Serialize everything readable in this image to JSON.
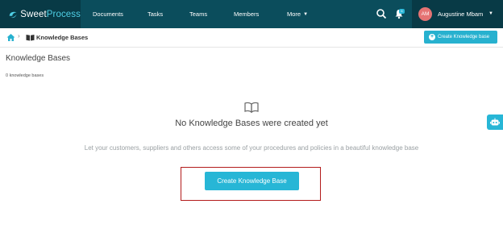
{
  "brand": {
    "name_part1": "Sweet",
    "name_part2": "Process"
  },
  "nav": {
    "items": [
      {
        "label": "Documents"
      },
      {
        "label": "Tasks"
      },
      {
        "label": "Teams"
      },
      {
        "label": "Members"
      },
      {
        "label": "More"
      }
    ],
    "notification_count": "6"
  },
  "user": {
    "initials": "AM",
    "name": "Augustine Mbam"
  },
  "breadcrumb": {
    "current": "Knowledge Bases"
  },
  "toolbar": {
    "create_label": "Create Knowledge base"
  },
  "page": {
    "title": "Knowledge Bases",
    "count_text": "0 knowledge bases"
  },
  "empty_state": {
    "title": "No Knowledge Bases were created yet",
    "description": "Let your customers, suppliers and others access some of your procedures and policies in a beautiful knowledge base",
    "button_label": "Create Knowledge Base"
  },
  "colors": {
    "nav_bg": "#0b4d5c",
    "accent": "#27b6d6",
    "highlight": "#b31b1b"
  }
}
